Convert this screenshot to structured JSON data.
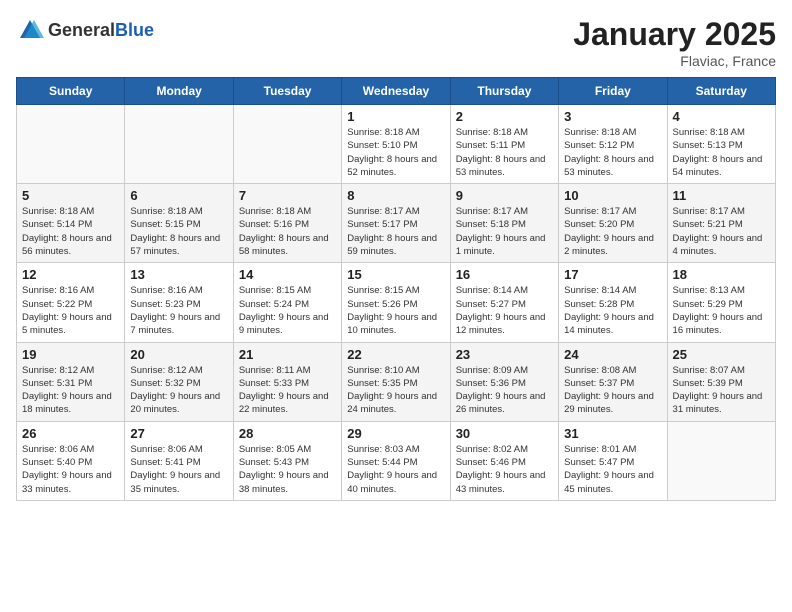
{
  "header": {
    "logo_general": "General",
    "logo_blue": "Blue",
    "month_title": "January 2025",
    "location": "Flaviac, France"
  },
  "weekdays": [
    "Sunday",
    "Monday",
    "Tuesday",
    "Wednesday",
    "Thursday",
    "Friday",
    "Saturday"
  ],
  "weeks": [
    [
      {
        "day": "",
        "info": ""
      },
      {
        "day": "",
        "info": ""
      },
      {
        "day": "",
        "info": ""
      },
      {
        "day": "1",
        "info": "Sunrise: 8:18 AM\nSunset: 5:10 PM\nDaylight: 8 hours and 52 minutes."
      },
      {
        "day": "2",
        "info": "Sunrise: 8:18 AM\nSunset: 5:11 PM\nDaylight: 8 hours and 53 minutes."
      },
      {
        "day": "3",
        "info": "Sunrise: 8:18 AM\nSunset: 5:12 PM\nDaylight: 8 hours and 53 minutes."
      },
      {
        "day": "4",
        "info": "Sunrise: 8:18 AM\nSunset: 5:13 PM\nDaylight: 8 hours and 54 minutes."
      }
    ],
    [
      {
        "day": "5",
        "info": "Sunrise: 8:18 AM\nSunset: 5:14 PM\nDaylight: 8 hours and 56 minutes."
      },
      {
        "day": "6",
        "info": "Sunrise: 8:18 AM\nSunset: 5:15 PM\nDaylight: 8 hours and 57 minutes."
      },
      {
        "day": "7",
        "info": "Sunrise: 8:18 AM\nSunset: 5:16 PM\nDaylight: 8 hours and 58 minutes."
      },
      {
        "day": "8",
        "info": "Sunrise: 8:17 AM\nSunset: 5:17 PM\nDaylight: 8 hours and 59 minutes."
      },
      {
        "day": "9",
        "info": "Sunrise: 8:17 AM\nSunset: 5:18 PM\nDaylight: 9 hours and 1 minute."
      },
      {
        "day": "10",
        "info": "Sunrise: 8:17 AM\nSunset: 5:20 PM\nDaylight: 9 hours and 2 minutes."
      },
      {
        "day": "11",
        "info": "Sunrise: 8:17 AM\nSunset: 5:21 PM\nDaylight: 9 hours and 4 minutes."
      }
    ],
    [
      {
        "day": "12",
        "info": "Sunrise: 8:16 AM\nSunset: 5:22 PM\nDaylight: 9 hours and 5 minutes."
      },
      {
        "day": "13",
        "info": "Sunrise: 8:16 AM\nSunset: 5:23 PM\nDaylight: 9 hours and 7 minutes."
      },
      {
        "day": "14",
        "info": "Sunrise: 8:15 AM\nSunset: 5:24 PM\nDaylight: 9 hours and 9 minutes."
      },
      {
        "day": "15",
        "info": "Sunrise: 8:15 AM\nSunset: 5:26 PM\nDaylight: 9 hours and 10 minutes."
      },
      {
        "day": "16",
        "info": "Sunrise: 8:14 AM\nSunset: 5:27 PM\nDaylight: 9 hours and 12 minutes."
      },
      {
        "day": "17",
        "info": "Sunrise: 8:14 AM\nSunset: 5:28 PM\nDaylight: 9 hours and 14 minutes."
      },
      {
        "day": "18",
        "info": "Sunrise: 8:13 AM\nSunset: 5:29 PM\nDaylight: 9 hours and 16 minutes."
      }
    ],
    [
      {
        "day": "19",
        "info": "Sunrise: 8:12 AM\nSunset: 5:31 PM\nDaylight: 9 hours and 18 minutes."
      },
      {
        "day": "20",
        "info": "Sunrise: 8:12 AM\nSunset: 5:32 PM\nDaylight: 9 hours and 20 minutes."
      },
      {
        "day": "21",
        "info": "Sunrise: 8:11 AM\nSunset: 5:33 PM\nDaylight: 9 hours and 22 minutes."
      },
      {
        "day": "22",
        "info": "Sunrise: 8:10 AM\nSunset: 5:35 PM\nDaylight: 9 hours and 24 minutes."
      },
      {
        "day": "23",
        "info": "Sunrise: 8:09 AM\nSunset: 5:36 PM\nDaylight: 9 hours and 26 minutes."
      },
      {
        "day": "24",
        "info": "Sunrise: 8:08 AM\nSunset: 5:37 PM\nDaylight: 9 hours and 29 minutes."
      },
      {
        "day": "25",
        "info": "Sunrise: 8:07 AM\nSunset: 5:39 PM\nDaylight: 9 hours and 31 minutes."
      }
    ],
    [
      {
        "day": "26",
        "info": "Sunrise: 8:06 AM\nSunset: 5:40 PM\nDaylight: 9 hours and 33 minutes."
      },
      {
        "day": "27",
        "info": "Sunrise: 8:06 AM\nSunset: 5:41 PM\nDaylight: 9 hours and 35 minutes."
      },
      {
        "day": "28",
        "info": "Sunrise: 8:05 AM\nSunset: 5:43 PM\nDaylight: 9 hours and 38 minutes."
      },
      {
        "day": "29",
        "info": "Sunrise: 8:03 AM\nSunset: 5:44 PM\nDaylight: 9 hours and 40 minutes."
      },
      {
        "day": "30",
        "info": "Sunrise: 8:02 AM\nSunset: 5:46 PM\nDaylight: 9 hours and 43 minutes."
      },
      {
        "day": "31",
        "info": "Sunrise: 8:01 AM\nSunset: 5:47 PM\nDaylight: 9 hours and 45 minutes."
      },
      {
        "day": "",
        "info": ""
      }
    ]
  ]
}
